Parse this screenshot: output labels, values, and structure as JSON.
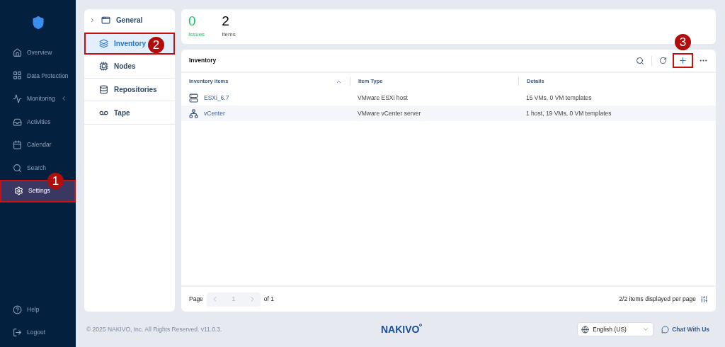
{
  "sidebar": {
    "items": [
      {
        "label": "Overview",
        "selected": false
      },
      {
        "label": "Data Protection",
        "selected": false
      },
      {
        "label": "Monitoring",
        "selected": false,
        "expandable": true
      },
      {
        "label": "Activities",
        "selected": false
      },
      {
        "label": "Calendar",
        "selected": false
      },
      {
        "label": "Search",
        "selected": false
      },
      {
        "label": "Settings",
        "selected": true,
        "outlined": true,
        "callout": "1"
      }
    ],
    "bottom_items": [
      {
        "label": "Help"
      },
      {
        "label": "Logout"
      }
    ]
  },
  "settings_menu": {
    "items": [
      {
        "label": "General",
        "selected": false,
        "expandable": true
      },
      {
        "label": "Inventory",
        "selected": true,
        "outlined": true,
        "callout": "2"
      },
      {
        "label": "Nodes",
        "selected": false
      },
      {
        "label": "Repositories",
        "selected": false
      },
      {
        "label": "Tape",
        "selected": false
      }
    ]
  },
  "stats": [
    {
      "value": "0",
      "label": "Issues",
      "kind": "good"
    },
    {
      "value": "2",
      "label": "Items",
      "kind": "plain"
    }
  ],
  "inventory": {
    "title": "Inventory",
    "add_callout": "3",
    "columns": [
      "Inventory items",
      "Item Type",
      "Details"
    ],
    "rows": [
      {
        "name": "ESXi_6.7",
        "kind": "host",
        "type": "VMware ESXi host",
        "details": "15 VMs, 0 VM templates"
      },
      {
        "name": "vCenter",
        "kind": "vcenter",
        "type": "VMware vCenter server",
        "details": "1 host, 19 VMs, 0 VM templates"
      }
    ],
    "pager": {
      "label": "Page",
      "page": "1",
      "of": "of 1",
      "per_page": "2/2 items displayed per page"
    }
  },
  "footer": {
    "copyright": "© 2025 NAKIVO, Inc. All Rights Reserved. v11.0.3.",
    "logo": "NAKIVO",
    "language": "English (US)",
    "chat": "Chat With Us"
  }
}
